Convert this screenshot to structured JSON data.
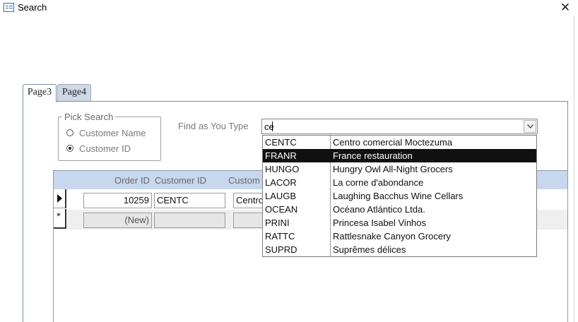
{
  "window": {
    "title": "Search",
    "close_glyph": "✕"
  },
  "tabs": [
    {
      "label": "Page3",
      "active": true
    },
    {
      "label": "Page4",
      "active": false
    }
  ],
  "pick_search": {
    "legend": "Pick Search",
    "options": [
      {
        "label": "Customer Name",
        "selected": false
      },
      {
        "label": "Customer ID",
        "selected": true
      }
    ]
  },
  "find": {
    "label": "Find as You Type",
    "value": "ce",
    "dropdown_icon": "chevron-down-icon",
    "results": [
      {
        "code": "CENTC",
        "name": "Centro comercial Moctezuma",
        "selected": false
      },
      {
        "code": "FRANR",
        "name": "France restauration",
        "selected": true
      },
      {
        "code": "HUNGO",
        "name": "Hungry Owl All-Night Grocers",
        "selected": false
      },
      {
        "code": "LACOR",
        "name": "La corne d'abondance",
        "selected": false
      },
      {
        "code": "LAUGB",
        "name": "Laughing Bacchus Wine Cellars",
        "selected": false
      },
      {
        "code": "OCEAN",
        "name": "Océano Atlántico Ltda.",
        "selected": false
      },
      {
        "code": "PRINI",
        "name": "Princesa Isabel Vinhos",
        "selected": false
      },
      {
        "code": "RATTC",
        "name": "Rattlesnake Canyon Grocery",
        "selected": false
      },
      {
        "code": "SUPRD",
        "name": "Suprêmes délices",
        "selected": false
      }
    ]
  },
  "subform": {
    "columns": [
      "Order ID",
      "Customer ID",
      "Custom"
    ],
    "rows": [
      {
        "order_id": "10259",
        "customer_id": "CENTC",
        "customer": "Centro"
      },
      {
        "order_id": "(New)",
        "customer_id": "",
        "customer": ""
      }
    ],
    "new_row_marker": "*"
  },
  "colors": {
    "header_band": "#c7d7ee",
    "selection": "#111111",
    "tab_inactive": "#cfd9e6"
  }
}
